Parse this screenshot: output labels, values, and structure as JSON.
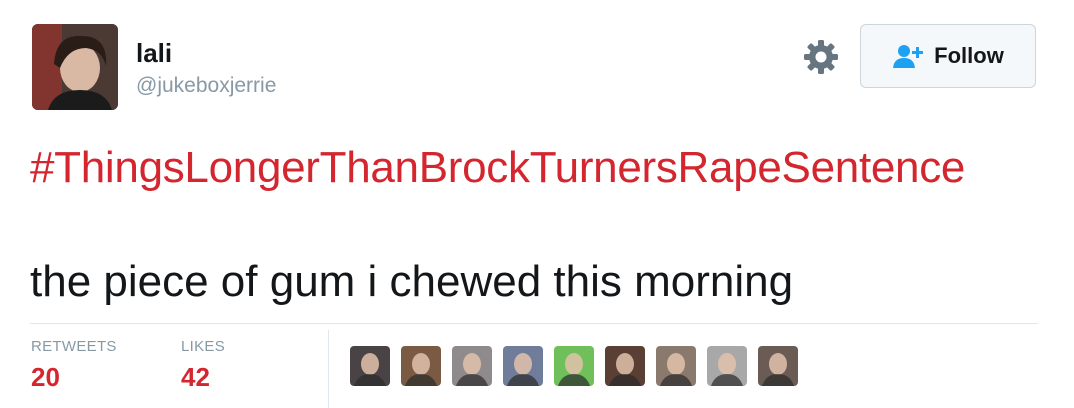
{
  "user": {
    "display_name": "lali",
    "handle": "@jukeboxjerrie"
  },
  "header": {
    "follow_label": "Follow",
    "icons": {
      "settings": "gear-icon",
      "follow": "add-user-icon"
    }
  },
  "tweet": {
    "hashtag": "#ThingsLongerThanBrockTurnersRapeSentence",
    "text": "the piece of gum i chewed this morning"
  },
  "stats": {
    "retweets_label": "RETWEETS",
    "retweets_count": "20",
    "likes_label": "LIKES",
    "likes_count": "42"
  },
  "likers": [
    {
      "color": "#4a4346"
    },
    {
      "color": "#7a5a42"
    },
    {
      "color": "#8f8a8c"
    },
    {
      "color": "#6f7c9a"
    },
    {
      "color": "#6fbf5a"
    },
    {
      "color": "#5a3f34"
    },
    {
      "color": "#8a7a6e"
    },
    {
      "color": "#a8a8a8"
    },
    {
      "color": "#6a5b55"
    }
  ],
  "colors": {
    "accent": "#d3262f",
    "link_blue": "#1da1f2",
    "muted": "#8899a6",
    "text": "#14171a"
  }
}
